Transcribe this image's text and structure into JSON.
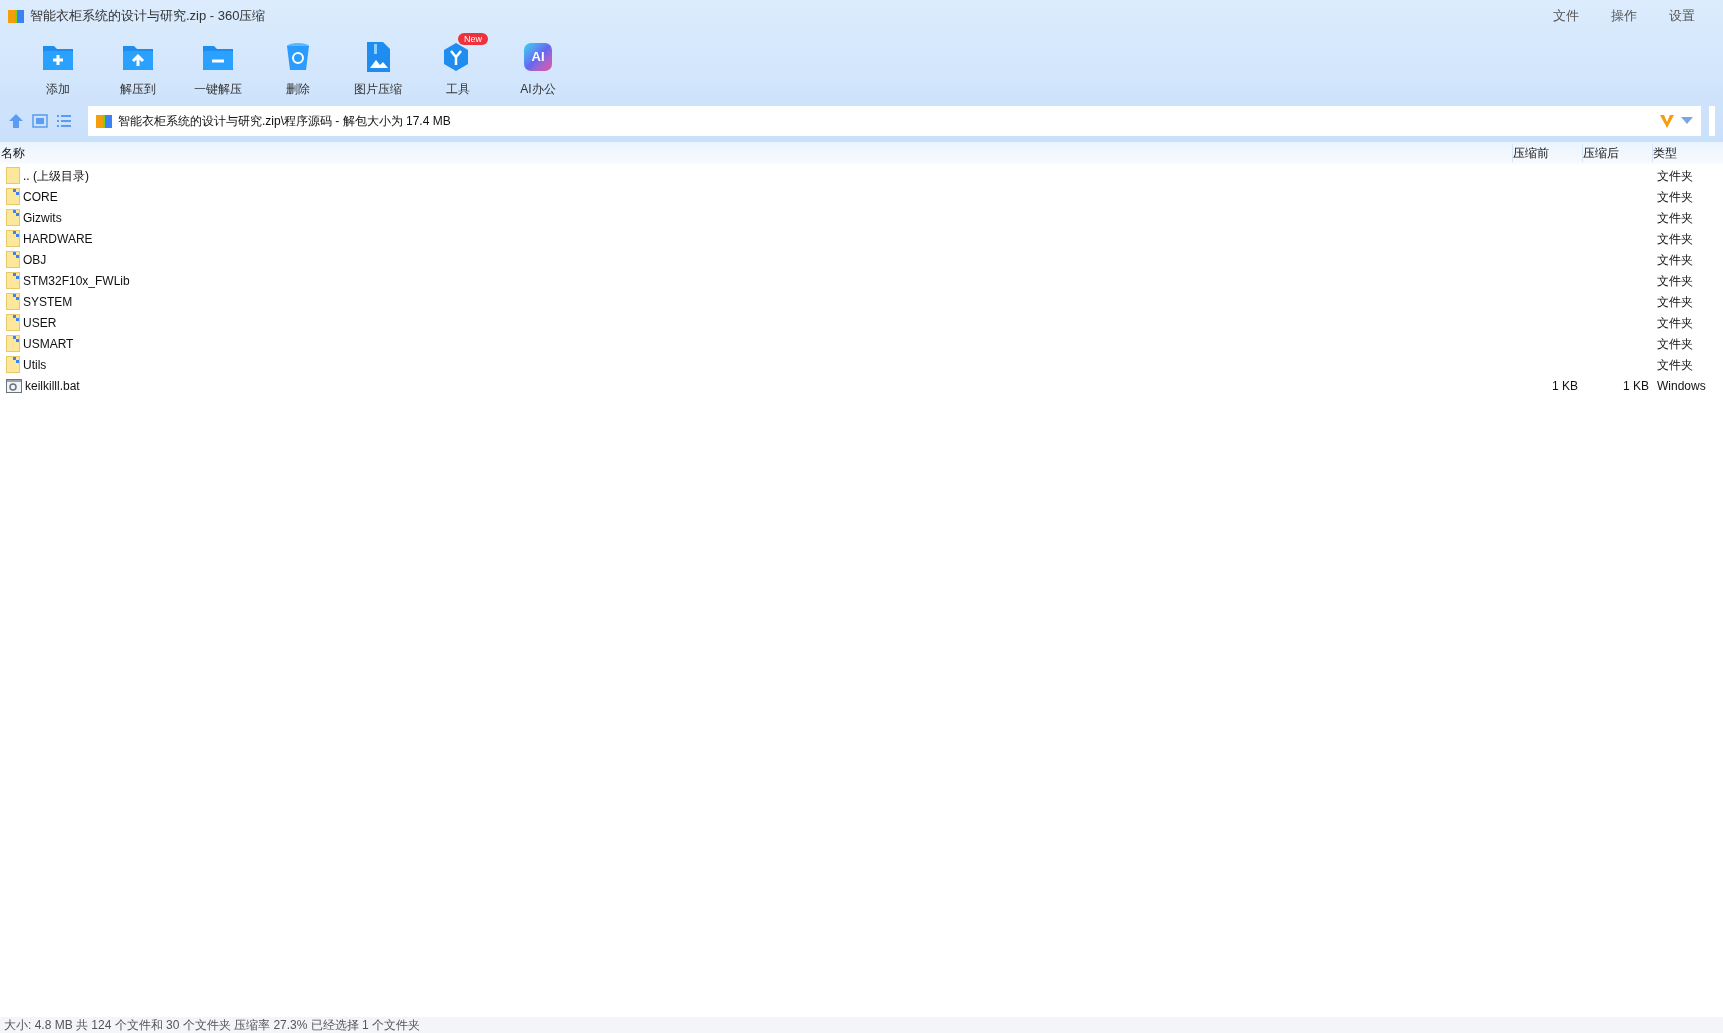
{
  "window": {
    "title": "智能衣柜系统的设计与研究.zip - 360压缩"
  },
  "menu": [
    "文件",
    "操作",
    "设置"
  ],
  "toolbar": [
    {
      "kind": "add",
      "label": "添加"
    },
    {
      "kind": "extract",
      "label": "解压到"
    },
    {
      "kind": "oneclick",
      "label": "一键解压"
    },
    {
      "kind": "delete",
      "label": "删除"
    },
    {
      "kind": "image",
      "label": "图片压缩"
    },
    {
      "kind": "tools",
      "label": "工具",
      "badge": "New"
    },
    {
      "kind": "ai",
      "label": "AI办公",
      "icon_text": "AI"
    }
  ],
  "address": {
    "path": "智能衣柜系统的设计与研究.zip\\程序源码 - 解包大小为 17.4 MB"
  },
  "table": {
    "columns": [
      "名称",
      "压缩前",
      "压缩后",
      "类型"
    ],
    "rows": [
      {
        "kind": "up",
        "name": ".. (上级目录)",
        "type": "文件夹"
      },
      {
        "kind": "folder",
        "name": "CORE",
        "type": "文件夹"
      },
      {
        "kind": "folder",
        "name": "Gizwits",
        "type": "文件夹"
      },
      {
        "kind": "folder",
        "name": "HARDWARE",
        "type": "文件夹"
      },
      {
        "kind": "folder",
        "name": "OBJ",
        "type": "文件夹"
      },
      {
        "kind": "folder",
        "name": "STM32F10x_FWLib",
        "type": "文件夹"
      },
      {
        "kind": "folder",
        "name": "SYSTEM",
        "type": "文件夹"
      },
      {
        "kind": "folder",
        "name": "USER",
        "type": "文件夹"
      },
      {
        "kind": "folder",
        "name": "USMART",
        "type": "文件夹"
      },
      {
        "kind": "folder",
        "name": "Utils",
        "type": "文件夹"
      },
      {
        "kind": "file",
        "name": "keilkilll.bat",
        "size": "1 KB",
        "packed": "1 KB",
        "type": "Windows"
      }
    ]
  },
  "status_bar": "大小: 4.8 MB 共 124 个文件和 30 个文件夹 压缩率 27.3% 已经选择 1 个文件夹"
}
